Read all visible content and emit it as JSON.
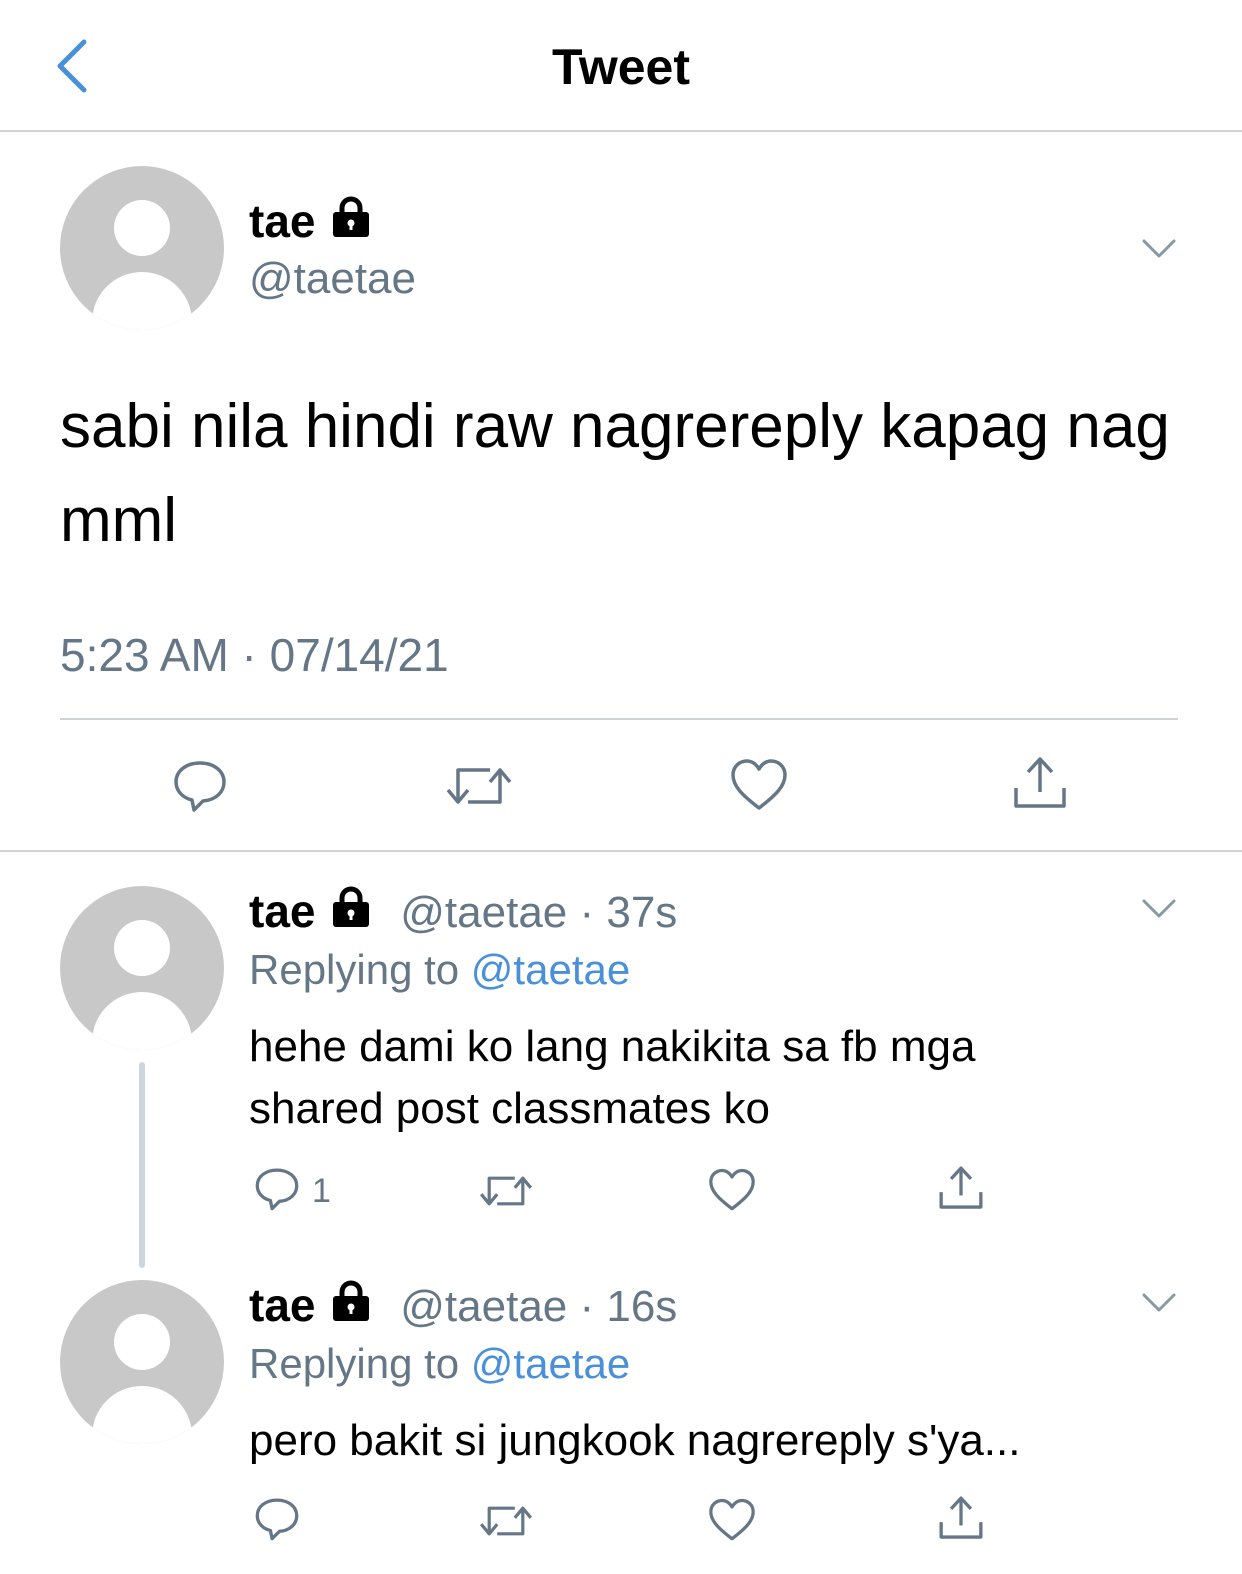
{
  "header": {
    "title": "Tweet",
    "back_icon": "chevron-left-icon"
  },
  "colors": {
    "accent": "#4a90d9",
    "secondary_text": "#657786",
    "divider": "#cfd3d6",
    "avatar": "#c8c8c8"
  },
  "main_tweet": {
    "name": "tae",
    "handle": "@taetae",
    "text": "sabi nila hindi raw nagrereply kapag nag mml",
    "timestamp": "5:23 AM · 07/14/21",
    "actions": [
      "reply-icon",
      "retweet-icon",
      "like-icon",
      "share-icon"
    ]
  },
  "replies": [
    {
      "name": "tae",
      "handle_time": "@taetae · 37s",
      "replying_prefix": "Replying to",
      "replying_to": "@taetae",
      "text_line1": "hehe dami ko lang nakikita sa fb mga",
      "text_line2": "shared post classmates ko",
      "reply_count": "1"
    },
    {
      "name": "tae",
      "handle_time": "@taetae · 16s",
      "replying_prefix": "Replying to",
      "replying_to": "@taetae",
      "text_line1": "pero bakit si jungkook nagrereply s'ya...",
      "text_line2": "",
      "reply_count": ""
    }
  ]
}
